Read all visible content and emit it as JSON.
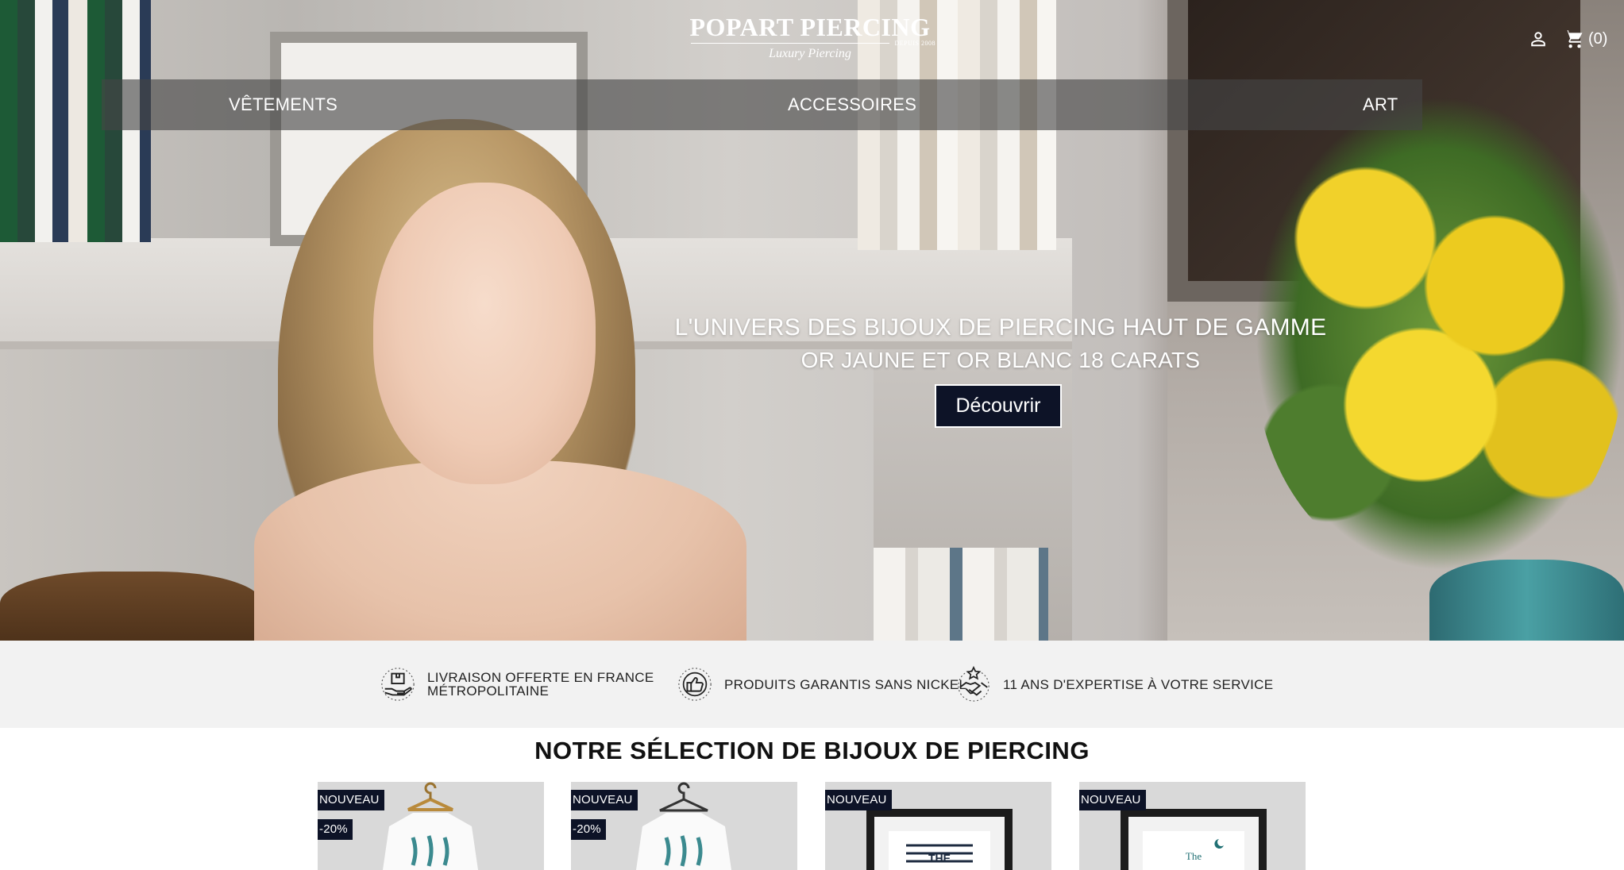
{
  "header": {
    "logo_title": "POPART PIERCING",
    "logo_since": "DEPUIS 2008",
    "logo_subtitle": "Luxury Piercing",
    "cart_count": "(0)",
    "icons": {
      "account": "user-icon",
      "cart": "cart-icon"
    }
  },
  "nav": {
    "items": [
      {
        "label": "VÊTEMENTS"
      },
      {
        "label": "ACCESSOIRES"
      },
      {
        "label": "ART"
      }
    ]
  },
  "hero": {
    "title_line1": "L'UNIVERS DES BIJOUX DE PIERCING HAUT DE GAMME",
    "title_line2": "OR JAUNE ET OR BLANC 18 CARATS",
    "cta_label": "Découvrir"
  },
  "reassurance": {
    "items": [
      {
        "line1": "LIVRAISON OFFERTE EN FRANCE",
        "line2": "MÉTROPOLITAINE",
        "icon": "delivery-hand-icon"
      },
      {
        "line1": "PRODUITS GARANTIS SANS NICKEL",
        "icon": "thumbs-up-badge-icon"
      },
      {
        "line1": "11 ANS D'EXPERTISE À VOTRE SERVICE",
        "icon": "handshake-star-icon"
      }
    ]
  },
  "selection": {
    "title": "NOTRE SÉLECTION DE BIJOUX DE PIERCING",
    "products": [
      {
        "flag_new": "NOUVEAU",
        "flag_discount": "-20%"
      },
      {
        "flag_new": "NOUVEAU",
        "flag_discount": "-20%"
      },
      {
        "flag_new": "NOUVEAU"
      },
      {
        "flag_new": "NOUVEAU"
      }
    ],
    "artwork_text": {
      "poster_1": "THE",
      "poster_2": "The"
    }
  },
  "colors": {
    "brand_dark": "#0d1327",
    "nav_overlay": "rgba(70,70,70,0.62)",
    "reassurance_bg": "#f2f2f2",
    "product_bg": "#d9d9d9"
  }
}
